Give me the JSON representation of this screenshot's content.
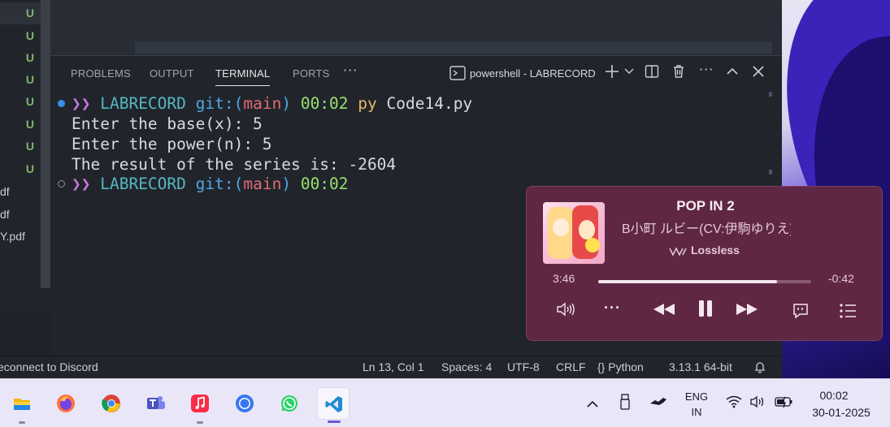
{
  "sidebar": {
    "rows": [
      {
        "label": "",
        "status": "U"
      },
      {
        "label": "",
        "status": "U"
      },
      {
        "label": "",
        "status": "U"
      },
      {
        "label": "",
        "status": "U"
      },
      {
        "label": "",
        "status": "U"
      },
      {
        "label": "",
        "status": "U"
      },
      {
        "label": "",
        "status": "U"
      },
      {
        "label": "",
        "status": "U"
      },
      {
        "label": "df",
        "status": ""
      },
      {
        "label": "df",
        "status": ""
      },
      {
        "label": "Y.pdf",
        "status": ""
      }
    ]
  },
  "panel": {
    "tabs": [
      "PROBLEMS",
      "OUTPUT",
      "TERMINAL",
      "PORTS"
    ],
    "more": "···",
    "terminal_name": "powershell - LABRECORD"
  },
  "terminal": {
    "prompt_arrow": "❯❯",
    "repo": "LABRECORD",
    "git_prefix": "git:(",
    "branch": "main",
    "git_suffix": ")",
    "time": "00:02",
    "command_word": "py",
    "command_arg": "Code14.py",
    "output": [
      "Enter the base(x): 5",
      "Enter the power(n): 5",
      "The result of the series is: -2604"
    ]
  },
  "statusbar": {
    "left": "econnect to Discord",
    "position": "Ln 13, Col 1",
    "spaces": "Spaces: 4",
    "encoding": "UTF-8",
    "eol": "CRLF",
    "language": "{} Python",
    "interpreter": "3.13.1 64-bit"
  },
  "media": {
    "title": "POP IN 2",
    "artist": "B小町 ルビー(CV:伊駒ゆりえ)",
    "quality": "Lossless",
    "elapsed": "3:46",
    "remaining": "-0:42",
    "progress": 0.84,
    "colors": {
      "panel": "#5f2743"
    }
  },
  "taskbar": {
    "apps": [
      "file-explorer",
      "firefox",
      "chrome",
      "teams",
      "apple-music",
      "signal",
      "whatsapp",
      "vscode"
    ],
    "lang_top": "ENG",
    "lang_bottom": "IN",
    "clock_time": "00:02",
    "clock_date": "30-01-2025"
  }
}
